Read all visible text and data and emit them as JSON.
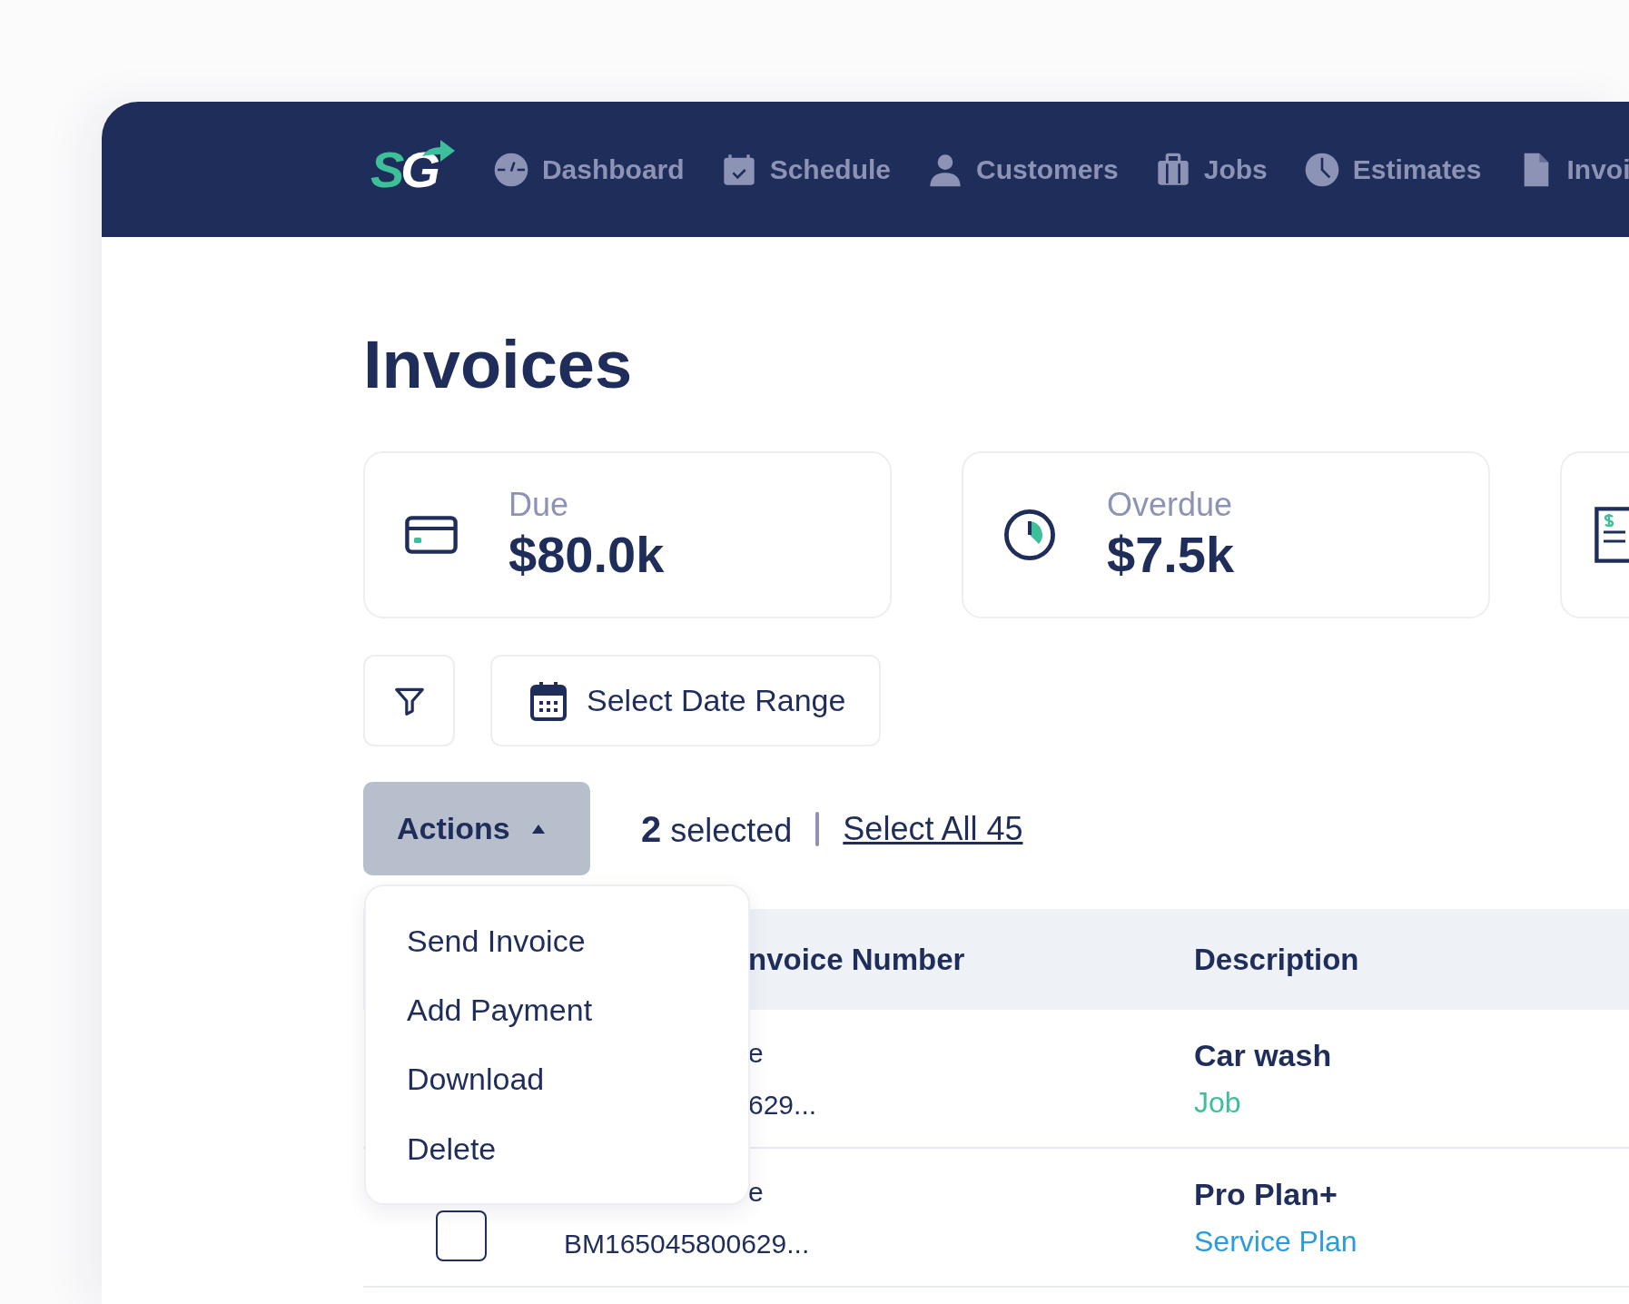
{
  "logo": {
    "parts": [
      {
        "text": "S",
        "color": "#3dbf9a"
      },
      {
        "text": "G",
        "color": "#ffffff"
      }
    ]
  },
  "nav": [
    {
      "label": "Dashboard"
    },
    {
      "label": "Schedule"
    },
    {
      "label": "Customers"
    },
    {
      "label": "Jobs"
    },
    {
      "label": "Estimates"
    },
    {
      "label": "Invoi"
    }
  ],
  "title": "Invoices",
  "cards": [
    {
      "kind": "stat",
      "label": "Due",
      "value": "$80.0k"
    },
    {
      "kind": "stat",
      "label": "Overdue",
      "value": "$7.5k"
    },
    {
      "kind": "cut"
    }
  ],
  "date_range": {
    "label": "Select Date Range"
  },
  "actions": {
    "label": "Actions",
    "expanded": true
  },
  "selection": {
    "count": "2",
    "text": "selected",
    "select_all": "Select All 45"
  },
  "menu": [
    {
      "label": "Send Invoice"
    },
    {
      "label": "Add Payment"
    },
    {
      "label": "Download"
    },
    {
      "label": "Delete"
    }
  ],
  "table": {
    "columns": [
      {
        "label": "nvoice Number"
      },
      {
        "label": "Description"
      }
    ],
    "rows": [
      {
        "invoice_lines": [
          "e",
          "629..."
        ],
        "description": "Car wash",
        "type": "Job",
        "color": "#3dbf9a"
      },
      {
        "checkbox": {
          "checked": false
        },
        "invoice_lines": [
          "e",
          "BM165045800629..."
        ],
        "description": "Pro Plan+",
        "type": "Service Plan",
        "color": "#2a9be0"
      }
    ]
  }
}
